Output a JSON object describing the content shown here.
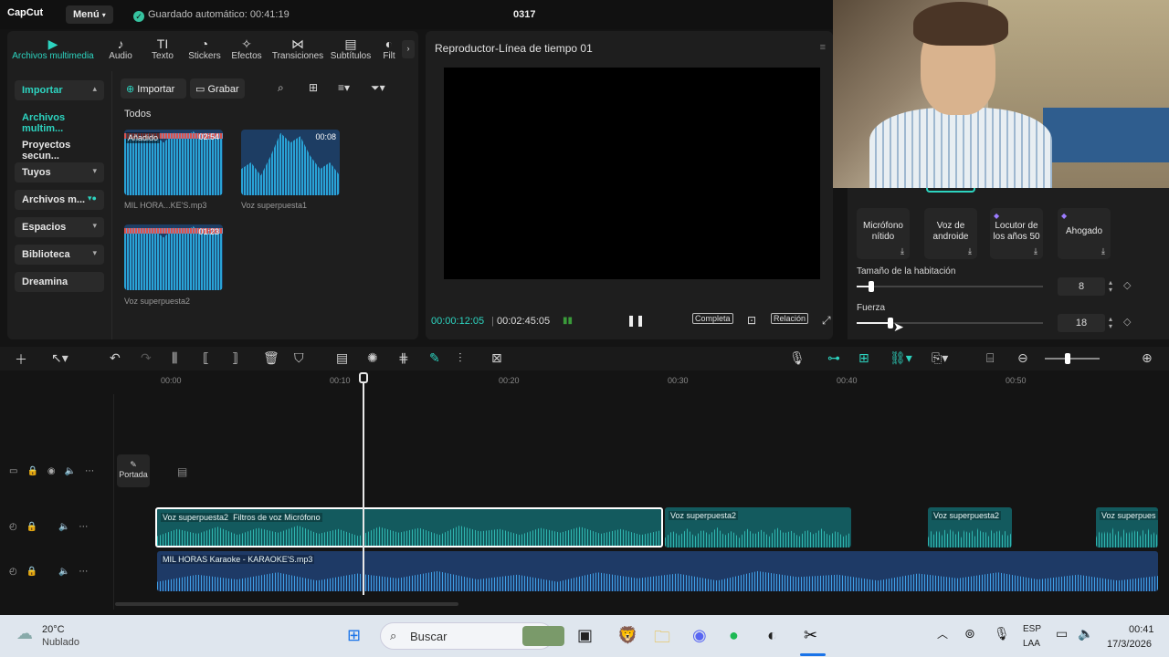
{
  "titlebar": {
    "logo": "CapCut",
    "menu": "Menú",
    "autosave": "Guardado automático: 00:41:19",
    "project": "0317"
  },
  "tabs": [
    {
      "label": "Archivos multimedia",
      "icon": "media-icon"
    },
    {
      "label": "Audio",
      "icon": "audio-icon"
    },
    {
      "label": "Texto",
      "icon": "text-icon"
    },
    {
      "label": "Stickers",
      "icon": "stickers-icon"
    },
    {
      "label": "Efectos",
      "icon": "effects-icon"
    },
    {
      "label": "Transiciones",
      "icon": "transitions-icon"
    },
    {
      "label": "Subtítulos",
      "icon": "subtitles-icon"
    },
    {
      "label": "Filt",
      "icon": "filters-icon"
    }
  ],
  "sidebar": {
    "items": [
      {
        "label": "Importar"
      },
      {
        "label": "Archivos multim..."
      },
      {
        "label": "Proyectos secun..."
      },
      {
        "label": "Tuyos"
      },
      {
        "label": "Archivos m..."
      },
      {
        "label": "Espacios"
      },
      {
        "label": "Biblioteca"
      },
      {
        "label": "Dreamina"
      }
    ]
  },
  "media": {
    "import_btn": "Importar",
    "record_btn": "Grabar",
    "section": "Todos",
    "items": [
      {
        "name": "MIL HORA...KE'S.mp3",
        "duration": "02:54",
        "badge": "Añadido"
      },
      {
        "name": "Voz superpuesta1",
        "duration": "00:08",
        "badge": ""
      },
      {
        "name": "Voz superpuesta2",
        "duration": "01:23",
        "badge": ""
      }
    ]
  },
  "player": {
    "title": "Reproductor-Línea de tiempo 01",
    "current": "00:00:12:05",
    "total": "00:02:45:05",
    "full": "Completa",
    "ratio": "Relación"
  },
  "voice_fx": {
    "cards": [
      {
        "label1": "Micrófono",
        "label2": "nítido",
        "premium": false
      },
      {
        "label1": "Voz de",
        "label2": "androide",
        "premium": false
      },
      {
        "label1": "Locutor de",
        "label2": "los años 50",
        "premium": true
      },
      {
        "label1": "Ahogado",
        "label2": "",
        "premium": true
      }
    ],
    "room_size_label": "Tamaño de la habitación",
    "room_size": 8,
    "room_size_value": "8",
    "strength_label": "Fuerza",
    "strength": 18,
    "strength_value": "18"
  },
  "timeline": {
    "ruler": [
      "00:00",
      "00:10",
      "00:20",
      "00:30",
      "00:40",
      "00:50"
    ],
    "cover_label": "Portada",
    "clips": [
      {
        "label": "Voz superpuesta2",
        "effect": "Filtros de voz Micrófono"
      },
      {
        "label": "Voz superpuesta2",
        "effect": ""
      },
      {
        "label": "Voz superpuesta2",
        "effect": ""
      },
      {
        "label": "Voz superpues",
        "effect": ""
      }
    ],
    "music_clip": "MIL HORAS Karaoke - KARAOKE'S.mp3"
  },
  "taskbar": {
    "weather_temp": "20°C",
    "weather_desc": "Nublado",
    "search_placeholder": "Buscar",
    "lang1": "ESP",
    "lang2": "LAA",
    "time": "00:41",
    "date": "17/3/2026"
  },
  "colors": {
    "accent": "#2dd4c0",
    "clip_teal": "#135a5e",
    "clip_blue": "#1e3a66"
  }
}
